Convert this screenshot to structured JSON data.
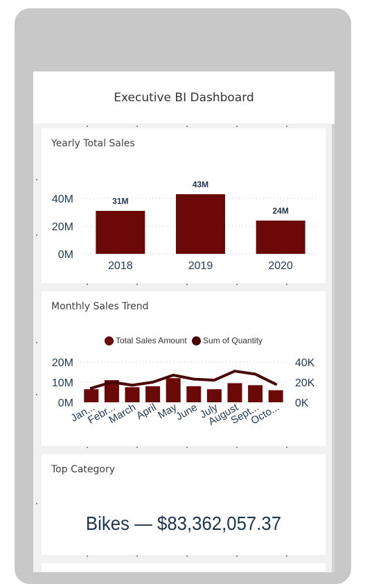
{
  "dashboard": {
    "title": "Executive BI Dashboard"
  },
  "colors": {
    "bar": "#6b0808",
    "line": "#4a0505",
    "axis_text": "#253a55",
    "grid": "#b6b6e6"
  },
  "yearly_card": {
    "title": "Yearly Total Sales"
  },
  "monthly_card": {
    "title": "Monthly Sales Trend",
    "legend": [
      "Total Sales Amount",
      "Sum of Quantity"
    ]
  },
  "category_card": {
    "title": "Top Category",
    "value": "Bikes — $83,362,057.37"
  },
  "chart_data": [
    {
      "type": "bar",
      "title": "Yearly Total Sales",
      "categories": [
        "2018",
        "2019",
        "2020"
      ],
      "values": [
        31,
        43,
        24
      ],
      "data_labels": [
        "31M",
        "43M",
        "24M"
      ],
      "yticks": [
        "0M",
        "20M",
        "40M"
      ],
      "ylim": [
        0,
        40
      ],
      "grid": true
    },
    {
      "type": "bar",
      "title": "Monthly Sales Trend",
      "categories": [
        "Jan...",
        "Febr...",
        "March",
        "April",
        "May",
        "June",
        "July",
        "August",
        "Sept...",
        "Octo..."
      ],
      "series": [
        {
          "name": "Total Sales Amount",
          "type": "bar",
          "axis": "left",
          "values": [
            6.5,
            11,
            7.5,
            8,
            12,
            8,
            6.5,
            9.5,
            8.5,
            6
          ]
        },
        {
          "name": "Sum of Quantity",
          "type": "line",
          "axis": "right",
          "values": [
            14,
            20,
            17,
            20,
            27,
            23,
            22,
            31,
            28,
            18
          ]
        }
      ],
      "yticks_left": [
        "0M",
        "10M",
        "20M"
      ],
      "yticks_right": [
        "0K",
        "20K",
        "40K"
      ],
      "ylim_left": [
        0,
        20
      ],
      "ylim_right": [
        0,
        40
      ],
      "legend": "top-center",
      "grid": true
    }
  ]
}
